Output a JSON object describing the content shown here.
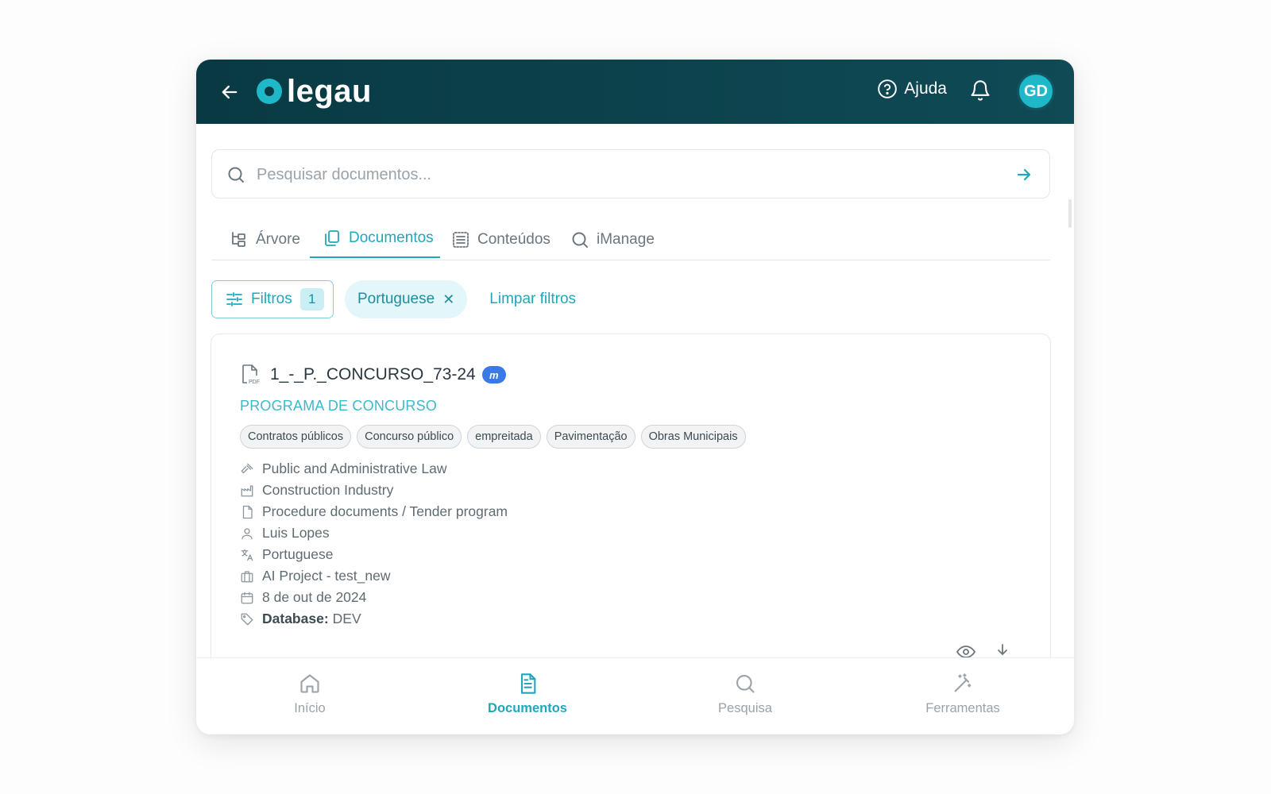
{
  "header": {
    "logo_text": "legau",
    "help_label": "Ajuda",
    "avatar_initials": "GD"
  },
  "search": {
    "placeholder": "Pesquisar documentos..."
  },
  "tabs": [
    {
      "label": "Árvore",
      "icon": "tree-icon",
      "active": false
    },
    {
      "label": "Documentos",
      "icon": "documents-icon",
      "active": true
    },
    {
      "label": "Conteúdos",
      "icon": "contents-icon",
      "active": false
    },
    {
      "label": "iManage",
      "icon": "search-icon",
      "active": false
    }
  ],
  "filters": {
    "button_label": "Filtros",
    "count": "1",
    "active_chip": "Portuguese",
    "chip_remove": "✕",
    "clear_label": "Limpar filtros"
  },
  "document": {
    "title": "1_-_P._CONCURSO_73-24",
    "badge": "m",
    "type": "PROGRAMA DE CONCURSO",
    "tags": [
      "Contratos públicos",
      "Concurso público",
      "empreitada",
      "Pavimentação",
      "Obras Municipais"
    ],
    "meta": {
      "area": "Public and Administrative Law",
      "industry": "Construction Industry",
      "category": "Procedure documents / Tender program",
      "author": "Luis Lopes",
      "language": "Portuguese",
      "project": "AI Project - test_new",
      "date": "8 de out de 2024",
      "database_label": "Database:",
      "database_value": "DEV"
    }
  },
  "bottom_nav": [
    {
      "label": "Início",
      "icon": "home-icon",
      "active": false
    },
    {
      "label": "Documentos",
      "icon": "document-icon",
      "active": true
    },
    {
      "label": "Pesquisa",
      "icon": "search-icon",
      "active": false
    },
    {
      "label": "Ferramentas",
      "icon": "magic-wand-icon",
      "active": false
    }
  ],
  "colors": {
    "header_bg": "#093a44",
    "accent": "#1fa7bb",
    "logo_dot": "#1fb8c9"
  }
}
